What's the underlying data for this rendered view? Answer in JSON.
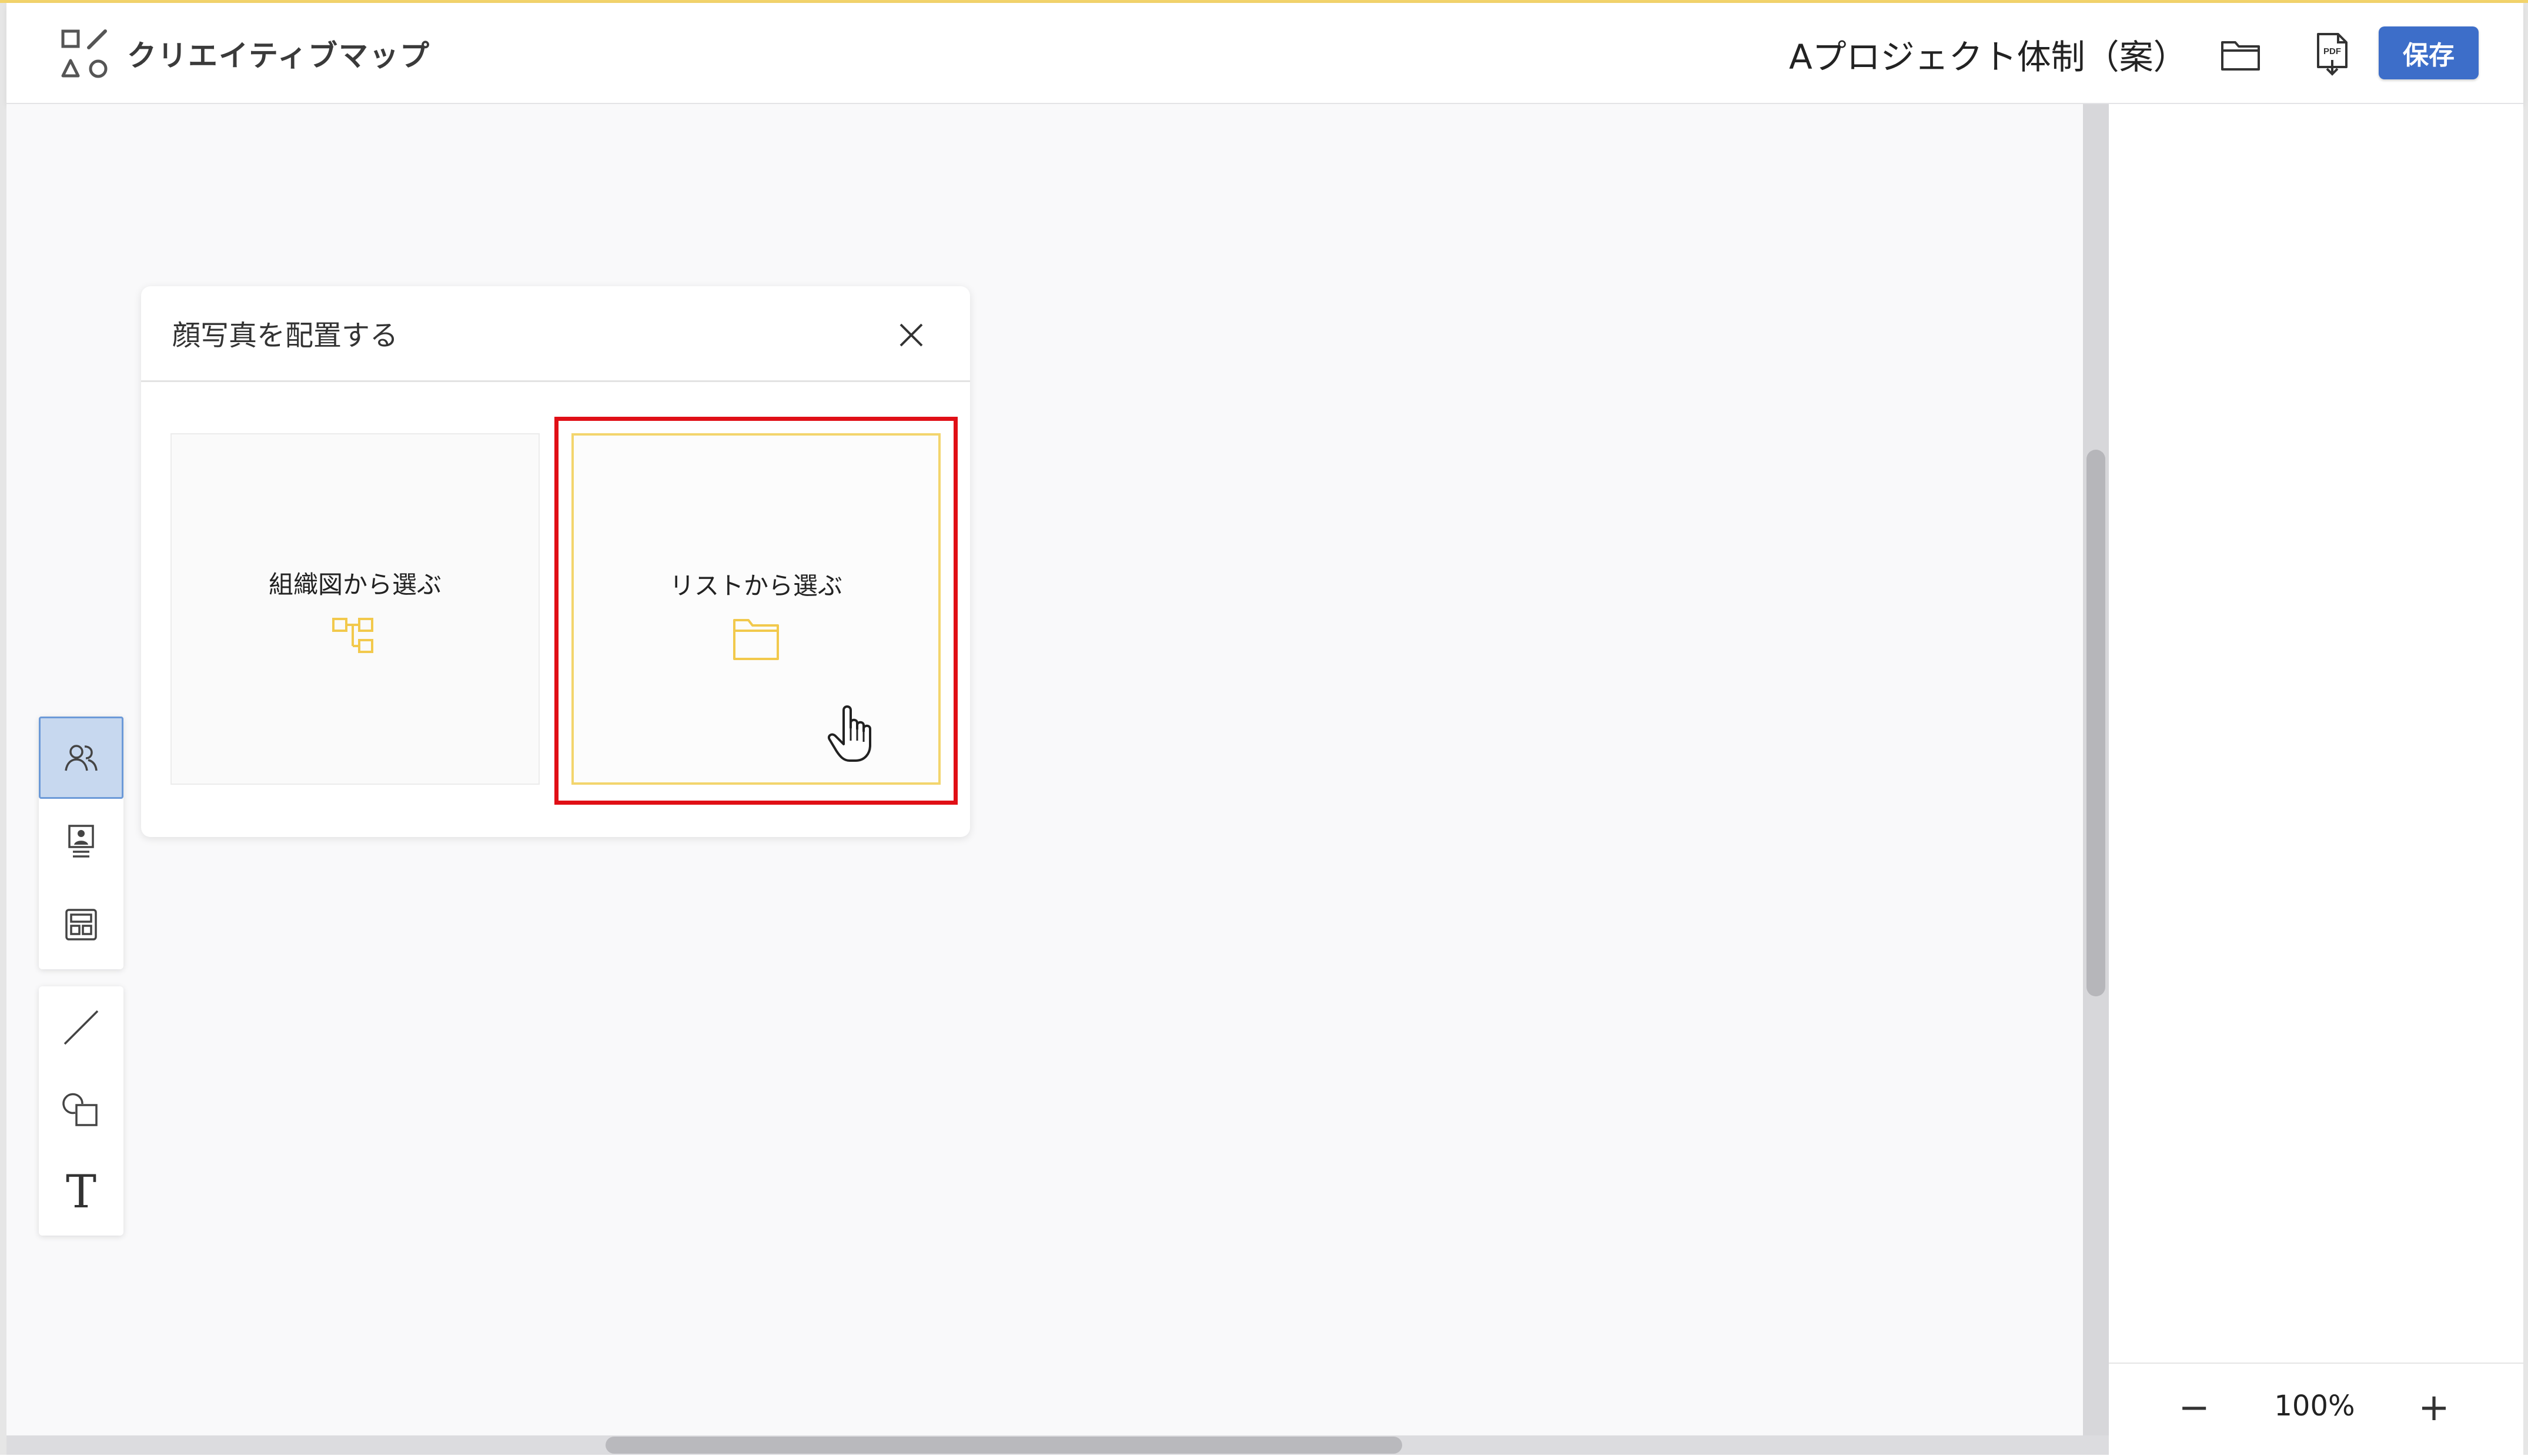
{
  "header": {
    "app_title": "クリエイティブマップ",
    "project_title": "Aプロジェクト体制（案）",
    "save_label": "保存",
    "pdf_icon_text": "PDF"
  },
  "dialog": {
    "title": "顔写真を配置する",
    "options": [
      {
        "label": "組織図から選ぶ",
        "icon": "org-chart-icon"
      },
      {
        "label": "リストから選ぶ",
        "icon": "folder-icon"
      }
    ]
  },
  "toolbar": {
    "group1": [
      "people-icon",
      "profile-card-icon",
      "layout-grid-icon"
    ],
    "group2": [
      "line-tool-icon",
      "shape-tool-icon",
      "text-tool-icon"
    ],
    "text_tool_glyph": "T"
  },
  "zoom": {
    "level": "100%",
    "minus": "−",
    "plus": "+"
  },
  "colors": {
    "accent": "#3d6ec9",
    "icon_yellow": "#f2c94c",
    "highlight_red": "#e00f16",
    "active_tool_bg": "#c7d8ef"
  }
}
